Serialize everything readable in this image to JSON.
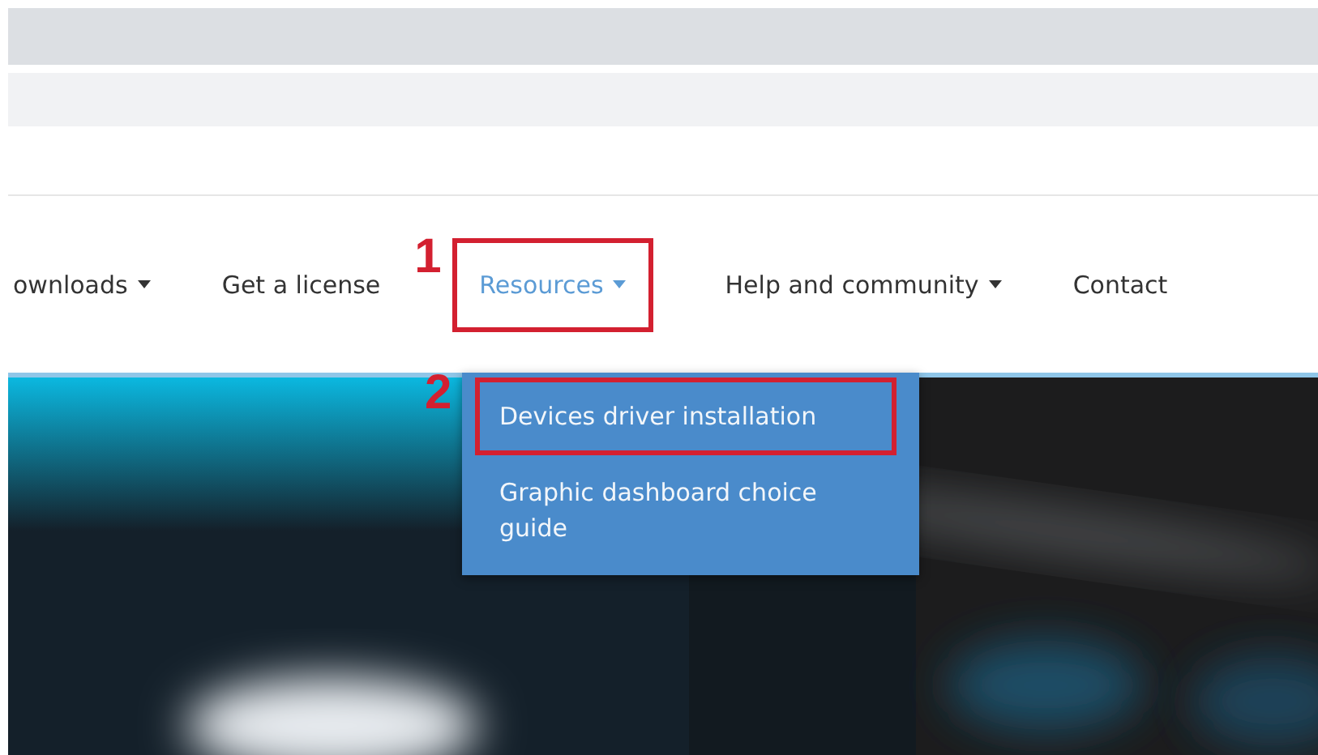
{
  "nav": {
    "items": [
      {
        "label": "ownloads",
        "caret": true,
        "selected": false
      },
      {
        "label": "Get a license",
        "caret": false,
        "selected": false
      },
      {
        "label": "Resources",
        "caret": true,
        "selected": true,
        "callout": "1"
      },
      {
        "label": "Help and community",
        "caret": true,
        "selected": false
      },
      {
        "label": "Contact",
        "caret": false,
        "selected": false
      }
    ]
  },
  "dropdown": {
    "callout": "2",
    "items": [
      {
        "label": "Devices driver installation",
        "marked": true
      },
      {
        "label": "Graphic dashboard choice guide",
        "marked": false
      }
    ]
  }
}
